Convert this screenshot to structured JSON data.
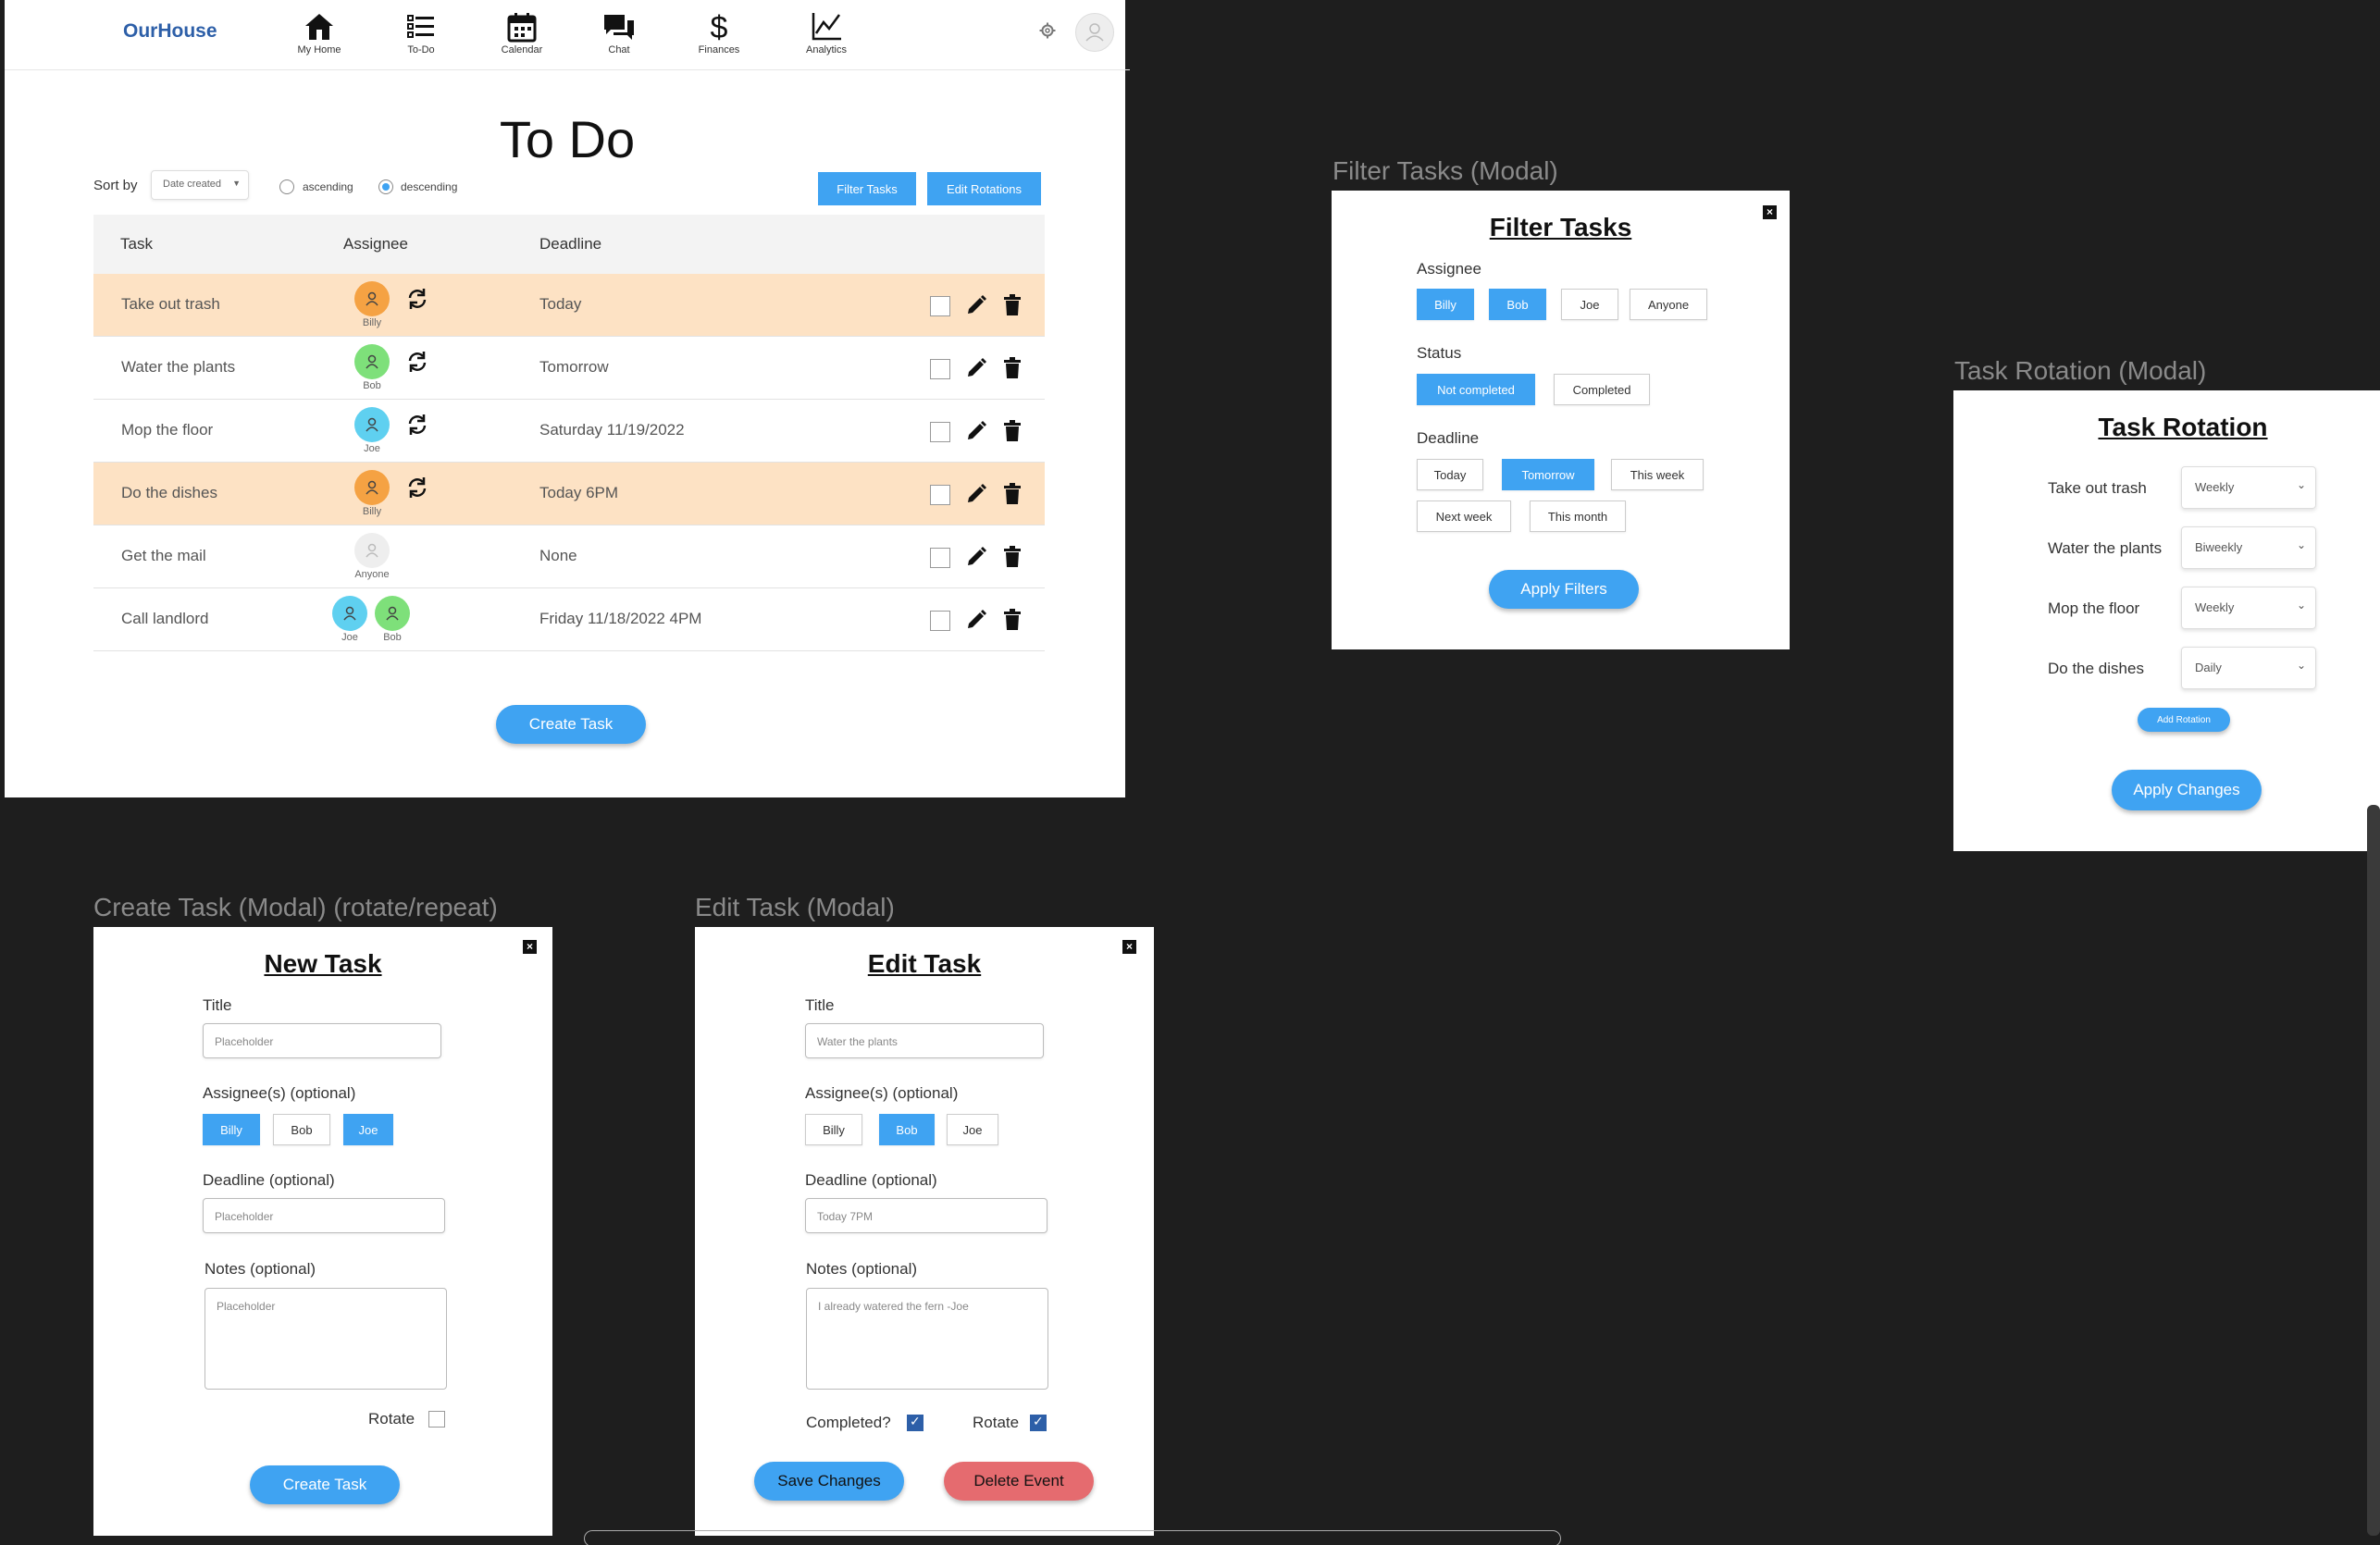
{
  "main": {
    "brand": "OurHouse",
    "nav": [
      {
        "label": "My Home",
        "icon": "home-icon"
      },
      {
        "label": "To-Do",
        "icon": "list-icon"
      },
      {
        "label": "Calendar",
        "icon": "calendar-icon"
      },
      {
        "label": "Chat",
        "icon": "chat-icon"
      },
      {
        "label": "Finances",
        "icon": "dollar-icon"
      },
      {
        "label": "Analytics",
        "icon": "chart-icon"
      }
    ],
    "title": "To Do",
    "sort_label": "Sort by",
    "sort_value": "Date created",
    "ascending": "ascending",
    "descending": "descending",
    "sort_order_selected": "descending",
    "filter_button": "Filter Tasks",
    "rotations_button": "Edit Rotations",
    "columns": {
      "task": "Task",
      "assignee": "Assignee",
      "deadline": "Deadline"
    },
    "rows": [
      {
        "task": "Take out trash",
        "assignees": [
          "Billy"
        ],
        "rotate": true,
        "deadline": "Today",
        "highlight": true
      },
      {
        "task": "Water the plants",
        "assignees": [
          "Bob"
        ],
        "rotate": true,
        "deadline": "Tomorrow",
        "highlight": false
      },
      {
        "task": "Mop the floor",
        "assignees": [
          "Joe"
        ],
        "rotate": true,
        "deadline": "Saturday 11/19/2022",
        "highlight": false
      },
      {
        "task": "Do the dishes",
        "assignees": [
          "Billy"
        ],
        "rotate": true,
        "deadline": "Today 6PM",
        "highlight": true
      },
      {
        "task": "Get the mail",
        "assignees": [
          "Anyone"
        ],
        "rotate": false,
        "deadline": "None",
        "highlight": false
      },
      {
        "task": "Call landlord",
        "assignees": [
          "Joe",
          "Bob"
        ],
        "rotate": false,
        "deadline": "Friday 11/18/2022 4PM",
        "highlight": false
      }
    ],
    "create_button": "Create Task"
  },
  "colors": {
    "accent": "#3fa3f2",
    "highlight_row": "#fde2c4",
    "brand": "#2d5fa8",
    "danger": "#e56b6f",
    "avatar_billy": "#f5a243",
    "avatar_bob": "#7ee07a",
    "avatar_joe": "#5fd0f0",
    "avatar_anyone": "#eeeeee"
  },
  "labels": {
    "filter_modal": "Filter Tasks (Modal)",
    "rotation_modal": "Task Rotation (Modal)",
    "create_modal": "Create Task (Modal) (rotate/repeat)",
    "edit_modal": "Edit Task (Modal)"
  },
  "filter": {
    "title": "Filter Tasks",
    "assignee_label": "Assignee",
    "assignee_options": [
      {
        "label": "Billy",
        "selected": true
      },
      {
        "label": "Bob",
        "selected": true
      },
      {
        "label": "Joe",
        "selected": false
      },
      {
        "label": "Anyone",
        "selected": false
      }
    ],
    "status_label": "Status",
    "status_options": [
      {
        "label": "Not completed",
        "selected": true
      },
      {
        "label": "Completed",
        "selected": false
      }
    ],
    "deadline_label": "Deadline",
    "deadline_options": [
      {
        "label": "Today",
        "selected": false
      },
      {
        "label": "Tomorrow",
        "selected": true
      },
      {
        "label": "This week",
        "selected": false
      },
      {
        "label": "Next week",
        "selected": false
      },
      {
        "label": "This month",
        "selected": false
      }
    ],
    "apply": "Apply Filters"
  },
  "rotation": {
    "title": "Task Rotation",
    "items": [
      {
        "task": "Take out trash",
        "frequency": "Weekly"
      },
      {
        "task": "Water the plants",
        "frequency": "Biweekly"
      },
      {
        "task": "Mop the floor",
        "frequency": "Weekly"
      },
      {
        "task": "Do the dishes",
        "frequency": "Daily"
      }
    ],
    "add": "Add Rotation",
    "apply": "Apply Changes"
  },
  "create": {
    "title": "New Task",
    "title_label": "Title",
    "title_placeholder": "Placeholder",
    "assignee_label": "Assignee(s) (optional)",
    "assignees": [
      {
        "label": "Billy",
        "selected": true
      },
      {
        "label": "Bob",
        "selected": false
      },
      {
        "label": "Joe",
        "selected": true
      }
    ],
    "deadline_label": "Deadline (optional)",
    "deadline_placeholder": "Placeholder",
    "notes_label": "Notes (optional)",
    "notes_placeholder": "Placeholder",
    "rotate_label": "Rotate",
    "submit": "Create Task"
  },
  "edit": {
    "title": "Edit Task",
    "title_label": "Title",
    "title_value": "Water the plants",
    "assignee_label": "Assignee(s) (optional)",
    "assignees": [
      {
        "label": "Billy",
        "selected": false
      },
      {
        "label": "Bob",
        "selected": true
      },
      {
        "label": "Joe",
        "selected": false
      }
    ],
    "deadline_label": "Deadline (optional)",
    "deadline_value": "Today 7PM",
    "notes_label": "Notes (optional)",
    "notes_value": "I already watered the fern -Joe",
    "completed_label": "Completed?",
    "rotate_label": "Rotate",
    "save": "Save Changes",
    "delete": "Delete Event"
  }
}
